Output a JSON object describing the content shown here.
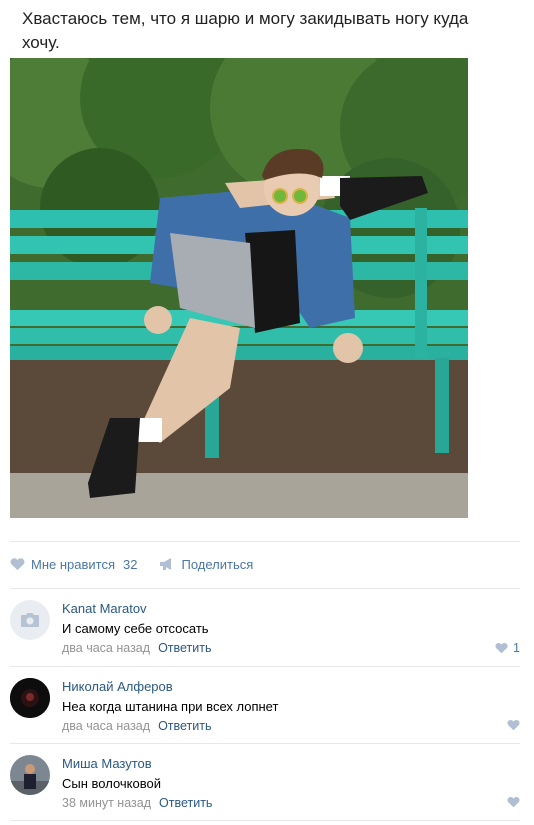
{
  "post": {
    "text": "Хвастаюсь тем, что я шарю и могу закидывать ногу куда хочу."
  },
  "actions": {
    "like_label": "Мне нравится",
    "like_count": "32",
    "share_label": "Поделиться",
    "like_icon": "heart-icon",
    "share_icon": "megaphone-icon"
  },
  "comments": [
    {
      "author": "Kanat Maratov",
      "text": "И самому себе отсосать",
      "time": "два часа назад",
      "reply": "Ответить",
      "likes": "1",
      "avatar": "camera-placeholder-icon"
    },
    {
      "author": "Николай Алферов",
      "text": "Неа когда штанина при всех лопнет",
      "time": "два часа назад",
      "reply": "Ответить",
      "likes": ""
    },
    {
      "author": "Миша Мазутов",
      "text": "Сын волочковой",
      "time": "38 минут назад",
      "reply": "Ответить",
      "likes": ""
    }
  ],
  "colors": {
    "link": "#2a5885",
    "action": "#4a76a8",
    "meta": "#939393",
    "divider": "#e7e8ec",
    "bench": "#2fbfae"
  }
}
